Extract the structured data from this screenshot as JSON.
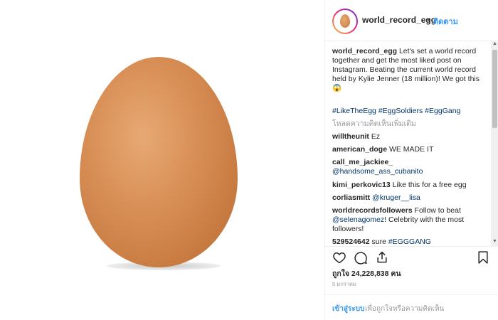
{
  "header": {
    "username": "world_record_egg",
    "dot": "•",
    "follow_label": "ติดตาม"
  },
  "caption": {
    "username": "world_record_egg",
    "text": "Let's set a world record together and get the most liked post on Instagram. Beating the current world record held by Kylie Jenner (18 million)! We got this 😱",
    "hashtags": "#LikeTheEgg #EggSoldiers #EggGang"
  },
  "load_more": "โหลดความคิดเห็นเพิ่มเติม",
  "comments": [
    {
      "user": "willtheunit",
      "text": "Ez",
      "mention": ""
    },
    {
      "user": "american_doge",
      "text": "WE MADE IT",
      "mention": ""
    },
    {
      "user": "call_me_jackiee_",
      "text": "",
      "mention": "@handsome_ass_cubanito"
    },
    {
      "user": "kimi_perkovic13",
      "text": "Like this for a free egg",
      "mention": ""
    },
    {
      "user": "corliasmitt",
      "text": "",
      "mention": "@kruger__lisa"
    },
    {
      "user": "worldrecordsfollowers",
      "text": "Follow to beat",
      "mention": "@selenagomez",
      "text2": "! Celebrity with the most followers!"
    },
    {
      "user": "529524642",
      "text": "sure",
      "mention": "#EGGGANG"
    }
  ],
  "likes_label": "ถูกใจ 24,228,838 คน",
  "date": "5 มกราคม",
  "login": {
    "link": "เข้าสู่ระบบ",
    "text": "เพื่อถูกใจหรือความคิดเห็น"
  },
  "colors": {
    "link_blue": "#3897f0",
    "hashtag": "#003569",
    "egg": "#d88f56"
  },
  "icons": [
    "heart-icon",
    "comment-icon",
    "share-icon",
    "bookmark-icon"
  ]
}
